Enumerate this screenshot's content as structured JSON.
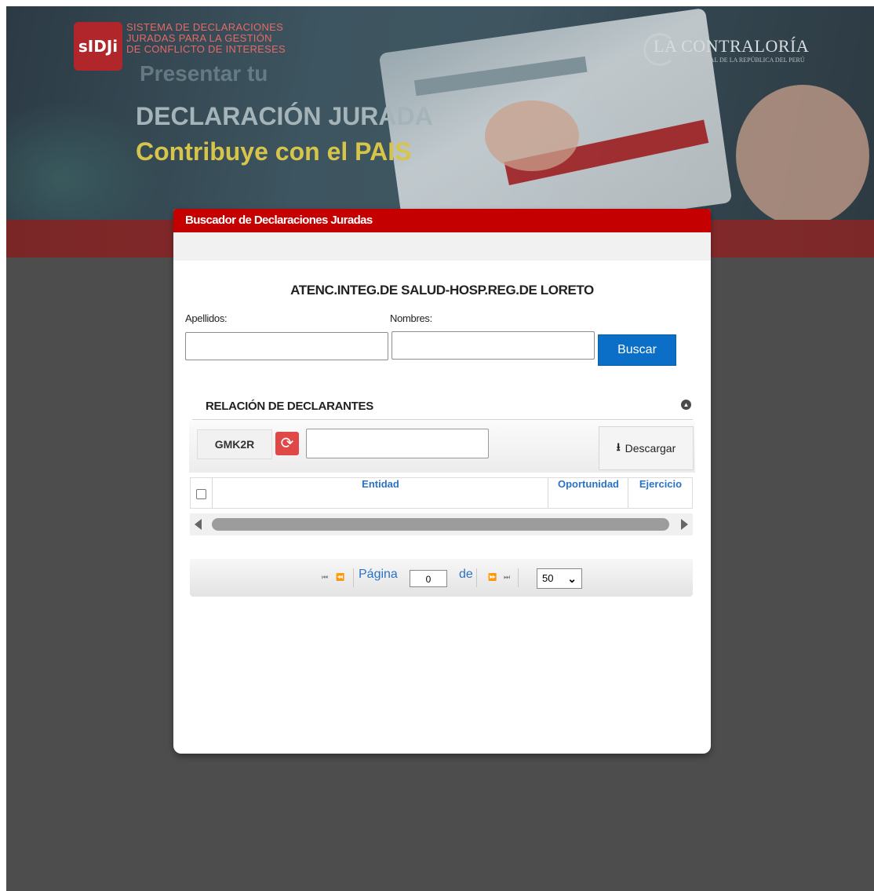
{
  "hero": {
    "logo": "sIDJi",
    "logo_text": [
      "SISTEMA DE DECLARACIONES",
      "JURADAS PARA LA GESTIÓN",
      "DE CONFLICTO DE INTERESES"
    ],
    "ghost_title": "Presentar tu",
    "title_line1": "DECLARACIÓN JURADA",
    "title_line2": "Contribuye con el PAIS",
    "org_name": "LA CONTRALORÍA",
    "org_sub": "GENERAL DE LA REPÚBLICA DEL PERÚ"
  },
  "modal": {
    "header_title": "Buscador de Declaraciones Juradas",
    "entity_name": "ATENC.INTEG.DE SALUD-HOSP.REG.DE LORETO",
    "apellidos_label": "Apellidos:",
    "nombres_label": "Nombres:",
    "apellidos_value": "",
    "nombres_value": "",
    "search_button": "Buscar",
    "relacion_title": "RELACIÓN DE DECLARANTES",
    "captcha_code": "GMK2R",
    "captcha_value": "",
    "download_button": "Descargar",
    "columns": [
      "Entidad",
      "Oportunidad",
      "Ejercicio"
    ],
    "pager": {
      "first": "⏮",
      "prev": "⏪",
      "page_label": "Página",
      "page_value": "0",
      "of_label": "de",
      "next": "⏩",
      "last": "⏭",
      "page_size": "50"
    }
  },
  "icons": {
    "refresh": "refresh-icon",
    "download": "download-icon",
    "collapse": "collapse-icon",
    "dropdown": "chevron-down-icon"
  },
  "colors": {
    "header_red": "#c40000",
    "primary_blue": "#0b6fc7",
    "link_blue": "#2a73c4",
    "refresh_red": "#e04848"
  }
}
